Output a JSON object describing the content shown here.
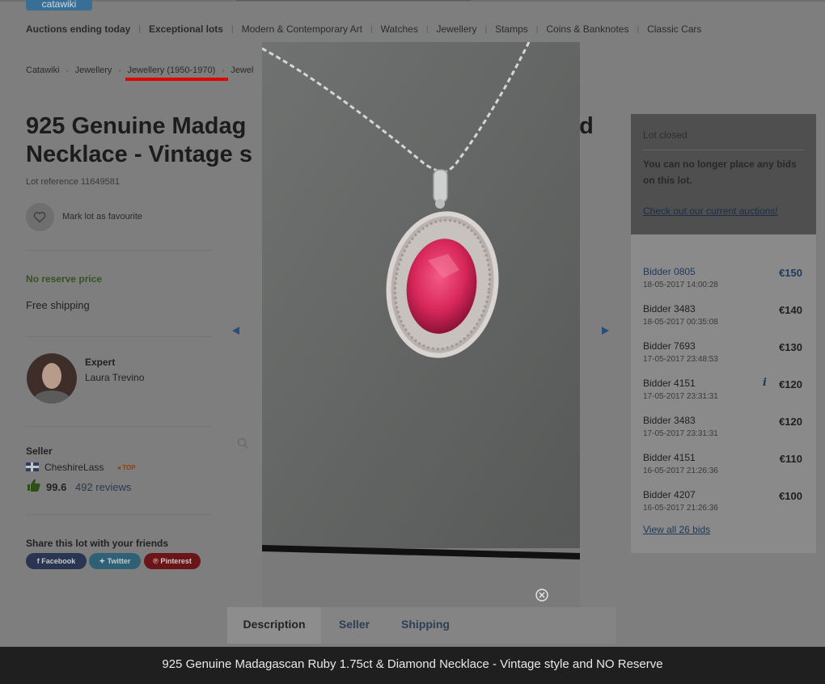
{
  "header": {
    "logo": "catawiki"
  },
  "nav": [
    {
      "label": "Auctions ending today",
      "bold": true
    },
    {
      "label": "Exceptional lots",
      "bold": true
    },
    {
      "label": "Modern & Contemporary Art",
      "bold": false
    },
    {
      "label": "Watches",
      "bold": false
    },
    {
      "label": "Jewellery",
      "bold": false
    },
    {
      "label": "Stamps",
      "bold": false
    },
    {
      "label": "Coins & Banknotes",
      "bold": false
    },
    {
      "label": "Classic Cars",
      "bold": false
    }
  ],
  "breadcrumb": [
    "Catawiki",
    "Jewellery",
    "Jewellery (1950-1970)",
    "Jewel"
  ],
  "lot": {
    "title_line1": "925 Genuine Madag",
    "title_line1_end": "nd",
    "title_line2": "Necklace - Vintage s",
    "reference": "Lot reference 11649581",
    "favourite_label": "Mark lot as favourite",
    "no_reserve": "No reserve price",
    "shipping": "Free shipping"
  },
  "expert": {
    "role": "Expert",
    "name": "Laura Trevino"
  },
  "seller": {
    "heading": "Seller",
    "name": "CheshireLass",
    "badge": "TOP",
    "score": "99.6",
    "reviews": "492 reviews"
  },
  "share": {
    "heading": "Share this lot with your friends",
    "facebook": "Facebook",
    "twitter": "Twitter",
    "pinterest": "Pinterest"
  },
  "tabs": [
    "Description",
    "Seller",
    "Shipping"
  ],
  "bid_panel": {
    "status": "Lot closed",
    "message": "You can no longer place any bids on this lot.",
    "link": "Check out our current auctions!",
    "view_all": "View all 26 bids",
    "bids": [
      {
        "bidder": "Bidder 0805",
        "time": "18-05-2017 14:00:28",
        "amount": "€150",
        "info": false
      },
      {
        "bidder": "Bidder 3483",
        "time": "18-05-2017 00:35:08",
        "amount": "€140",
        "info": false
      },
      {
        "bidder": "Bidder 7693",
        "time": "17-05-2017 23:48:53",
        "amount": "€130",
        "info": false
      },
      {
        "bidder": "Bidder 4151",
        "time": "17-05-2017 23:31:31",
        "amount": "€120",
        "info": true
      },
      {
        "bidder": "Bidder 3483",
        "time": "17-05-2017 23:31:31",
        "amount": "€120",
        "info": false
      },
      {
        "bidder": "Bidder 4151",
        "time": "16-05-2017 21:26:36",
        "amount": "€110",
        "info": false
      },
      {
        "bidder": "Bidder 4207",
        "time": "16-05-2017 21:26:36",
        "amount": "€100",
        "info": false
      }
    ]
  },
  "lightbox": {
    "caption": "925 Genuine Madagascan Ruby 1.75ct & Diamond Necklace - Vintage style and NO Reserve"
  },
  "colors": {
    "ruby": "#d8285a",
    "chain": "#d9d9d9",
    "highlight": "#e00000"
  }
}
